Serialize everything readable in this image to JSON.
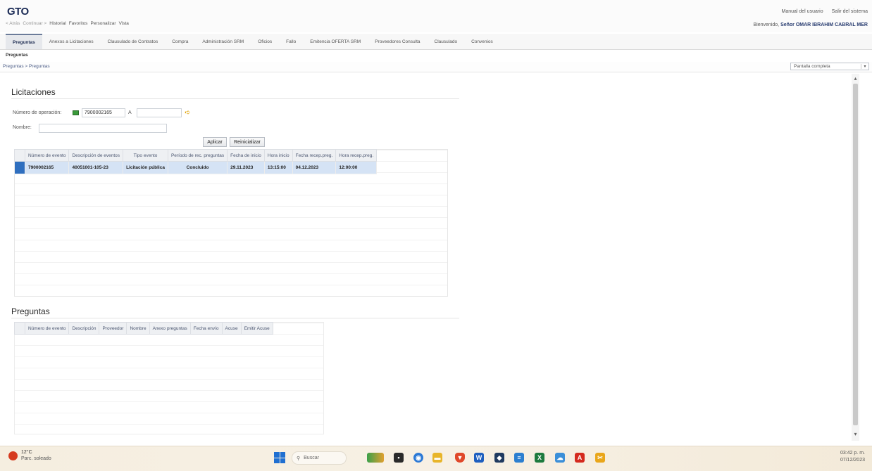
{
  "header": {
    "logo": "GTO",
    "nav": {
      "back": "< Atrás",
      "forward": "Continuar >",
      "history": "Historial",
      "favorites": "Favoritos",
      "personalize": "Personalizar",
      "view": "Vista"
    },
    "manual": "Manual del usuario",
    "logout": "Salir del sistema",
    "welcome_prefix": "Bienvenido,",
    "welcome_user": "Señor OMAR IBRAHIM CABRAL MER"
  },
  "tabs": [
    "Preguntas",
    "Anexos a Licitaciones",
    "Clausulado de Contratos",
    "Compra",
    "Administración SRM",
    "Oficios",
    "Fallo",
    "Emitencia OFERTA SRM",
    "Proveedores Consulta",
    "Clausulado",
    "Convenios"
  ],
  "subtab": "Preguntas",
  "breadcrumb": "Preguntas > Preguntas",
  "fullscreen": {
    "label": "Pantalla completa",
    "caret": "▾"
  },
  "licitaciones": {
    "title": "Licitaciones",
    "num_label": "Número de operación:",
    "num_from": "7900002165",
    "a_label": "A",
    "num_to": "",
    "nombre_label": "Nombre:",
    "nombre_value": "",
    "apply": "Aplicar",
    "reset": "Reinicializar",
    "columns": [
      "Número de evento",
      "Descripción de eventos",
      "Tipo evento",
      "Período de rec. preguntas",
      "Fecha de inicio",
      "Hora inicio",
      "Fecha recep.preg.",
      "Hora recep.preg."
    ],
    "rows": [
      [
        "7900002165",
        "40051001-105-23",
        "Licitación pública",
        "Concluido",
        "29.11.2023",
        "13:15:00",
        "04.12.2023",
        "12:00:00"
      ]
    ]
  },
  "preguntas": {
    "title": "Preguntas",
    "columns": [
      "Número de evento",
      "Descripción",
      "Proveedor",
      "Nombre",
      "Anexo preguntas",
      "Fecha envío",
      "Acuse",
      "Emitir Acuse"
    ]
  },
  "taskbar": {
    "temp": "12°C",
    "weather": "Parc. soleado",
    "search": "Buscar",
    "time": "03:42 p. m.",
    "date": "07/12/2023"
  }
}
